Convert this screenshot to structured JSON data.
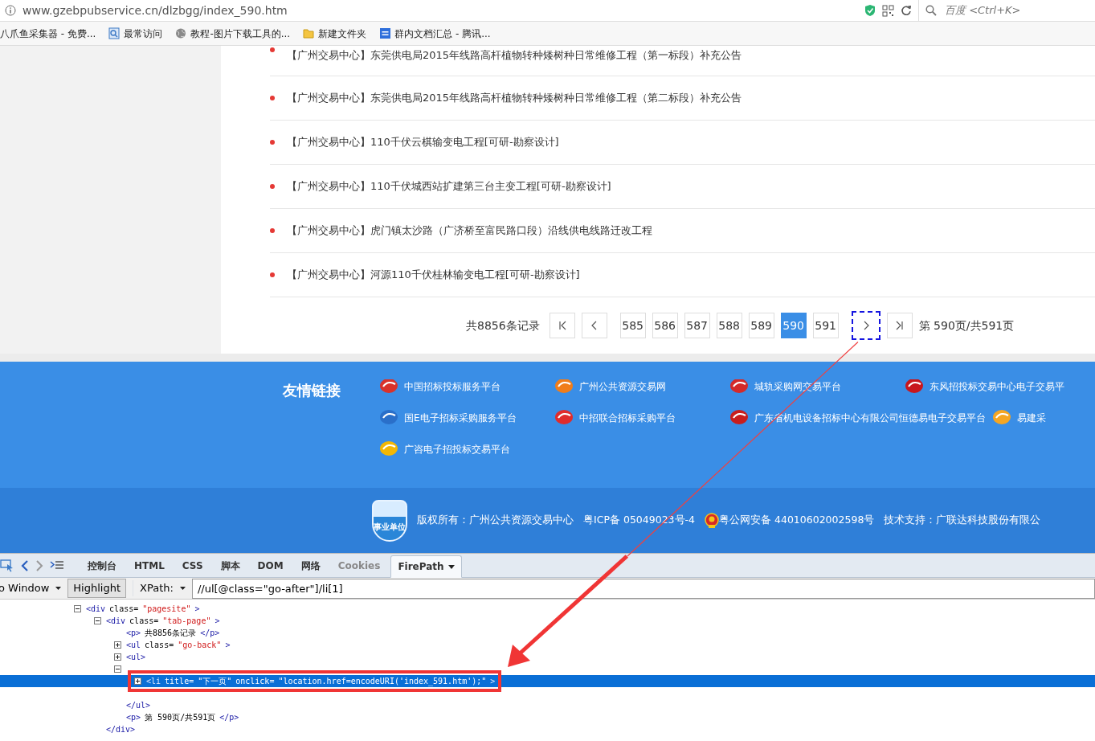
{
  "address_bar": {
    "url": "www.gzebpubservice.cn/dlzbgg/index_590.htm",
    "search_placeholder": "百度 <Ctrl+K>"
  },
  "bookmarks": [
    {
      "kind": "plain",
      "label": "八爪鱼采集器 - 免费..."
    },
    {
      "kind": "page",
      "label": "最常访问"
    },
    {
      "kind": "globe",
      "label": "教程-图片下载工具的..."
    },
    {
      "kind": "folder",
      "label": "新建文件夹"
    },
    {
      "kind": "doc",
      "label": "群内文档汇总 - 腾讯..."
    }
  ],
  "announcements": [
    "【广州交易中心】东莞供电局2015年线路高杆植物转种矮树种日常维修工程（第一标段）补充公告",
    "【广州交易中心】东莞供电局2015年线路高杆植物转种矮树种日常维修工程（第二标段）补充公告",
    "【广州交易中心】110千伏云棋输变电工程[可研-勘察设计]",
    "【广州交易中心】110千伏城西站扩建第三台主变工程[可研-勘察设计]",
    "【广州交易中心】虎门镇太沙路（广济桥至富民路口段）沿线供电线路迁改工程",
    "【广州交易中心】河源110千伏桂林输变电工程[可研-勘察设计]"
  ],
  "pagination": {
    "total": "共8856条记录",
    "pages": [
      {
        "label": "585",
        "selected": false
      },
      {
        "label": "586",
        "selected": false
      },
      {
        "label": "587",
        "selected": false
      },
      {
        "label": "588",
        "selected": false
      },
      {
        "label": "589",
        "selected": false
      },
      {
        "label": "590",
        "selected": true
      },
      {
        "label": "591",
        "selected": false
      }
    ],
    "next_focused": true,
    "page_info": "第 590页/共591页"
  },
  "footer": {
    "links_title": "友情链接",
    "link_rows": [
      [
        {
          "label": "中国招标投标服务平台",
          "color": "#d9322b"
        },
        {
          "label": "广州公共资源交易网",
          "color": "#f07d1a"
        },
        {
          "label": "城轨采购网交易平台",
          "color": "#d42a2a"
        },
        {
          "label": "东风招投标交易中心电子交易平",
          "color": "#c8161d"
        }
      ],
      [
        {
          "label": "国E电子招标采购服务平台",
          "color": "#2a6fc9"
        },
        {
          "label": "中招联合招标采购平台",
          "color": "#e02c2c"
        },
        {
          "label": "广东省机电设备招标中心有限公司恒德易电子交易平台",
          "color": "#c81e1e"
        },
        {
          "label": "易建采",
          "color": "#f5a623"
        }
      ],
      [
        {
          "label": "广咨电子招投标交易平台",
          "color": "#f2b705"
        }
      ]
    ],
    "emblem_text": "事业单位",
    "copyright": [
      {
        "kind": "plain",
        "text": "版权所有：广州公共资源交易中心"
      },
      {
        "kind": "plain",
        "text": "粤ICP备 05049023号-4"
      },
      {
        "kind": "police",
        "text": "粤公网安备 44010602002598号"
      },
      {
        "kind": "plain",
        "text": "技术支持：广联达科技股份有限公"
      }
    ]
  },
  "devtools": {
    "tabs": [
      {
        "label": "控制台",
        "selected": false,
        "disabled": false
      },
      {
        "label": "HTML",
        "selected": false,
        "disabled": false
      },
      {
        "label": "CSS",
        "selected": false,
        "disabled": false
      },
      {
        "label": "脚本",
        "selected": false,
        "disabled": false
      },
      {
        "label": "DOM",
        "selected": false,
        "disabled": false
      },
      {
        "label": "网络",
        "selected": false,
        "disabled": false
      },
      {
        "label": "Cookies",
        "selected": false,
        "disabled": true
      },
      {
        "label": "FirePath",
        "selected": true,
        "disabled": false
      }
    ],
    "window_select": "o Window",
    "highlight_button": "Highlight",
    "xpath_label": "XPath:",
    "xpath_value": "//ul[@class=\"go-after\"]/li[1]",
    "tree": [
      {
        "expanded": true,
        "selected": false,
        "parts": [
          {
            "kind": "tag",
            "text": "<div"
          },
          {
            "kind": "attr",
            "text": "class="
          },
          {
            "kind": "value",
            "text": "\"pagesite\""
          },
          {
            "kind": "tag",
            "text": ">"
          }
        ],
        "children": [
          {
            "expanded": true,
            "selected": false,
            "parts": [
              {
                "kind": "tag",
                "text": "<div"
              },
              {
                "kind": "attr",
                "text": "class="
              },
              {
                "kind": "value",
                "text": "\"tab-page\""
              },
              {
                "kind": "tag",
                "text": ">"
              }
            ],
            "closing": [
              {
                "kind": "tag",
                "text": "</div>"
              }
            ],
            "children": [
              {
                "selected": false,
                "parts": [
                  {
                    "kind": "tag",
                    "text": "<p>"
                  },
                  {
                    "kind": "text",
                    "text": "共8856条记录"
                  },
                  {
                    "kind": "tag",
                    "text": "</p>"
                  }
                ]
              },
              {
                "expanded": false,
                "selected": false,
                "parts": [
                  {
                    "kind": "tag",
                    "text": "<ul"
                  },
                  {
                    "kind": "attr",
                    "text": "class="
                  },
                  {
                    "kind": "value",
                    "text": "\"go-back\""
                  },
                  {
                    "kind": "tag",
                    "text": ">"
                  }
                ]
              },
              {
                "expanded": false,
                "selected": false,
                "parts": [
                  {
                    "kind": "tag",
                    "text": "<ul>"
                  }
                ]
              },
              {
                "expanded": true,
                "selected": false,
                "closing": [
                  {
                    "kind": "tag",
                    "text": "</ul>"
                  }
                ],
                "children": [
                  {
                    "expanded": false,
                    "selected": true,
                    "parts": [
                      {
                        "kind": "tag",
                        "text": "<li"
                      },
                      {
                        "kind": "attr",
                        "text": "title="
                      },
                      {
                        "kind": "value",
                        "text": "\"下一页\""
                      },
                      {
                        "kind": "attr",
                        "text": "onclick="
                      },
                      {
                        "kind": "value",
                        "text": "\"location.href=encodeURI('index_591.htm');\""
                      },
                      {
                        "kind": "tag",
                        "text": ">"
                      }
                    ]
                  }
                ]
              },
              {
                "selected": false,
                "parts": [
                  {
                    "kind": "tag",
                    "text": "<p>"
                  },
                  {
                    "kind": "text",
                    "text": "第 590页/共591页"
                  },
                  {
                    "kind": "tag",
                    "text": "</p>"
                  }
                ]
              }
            ]
          }
        ]
      }
    ]
  }
}
